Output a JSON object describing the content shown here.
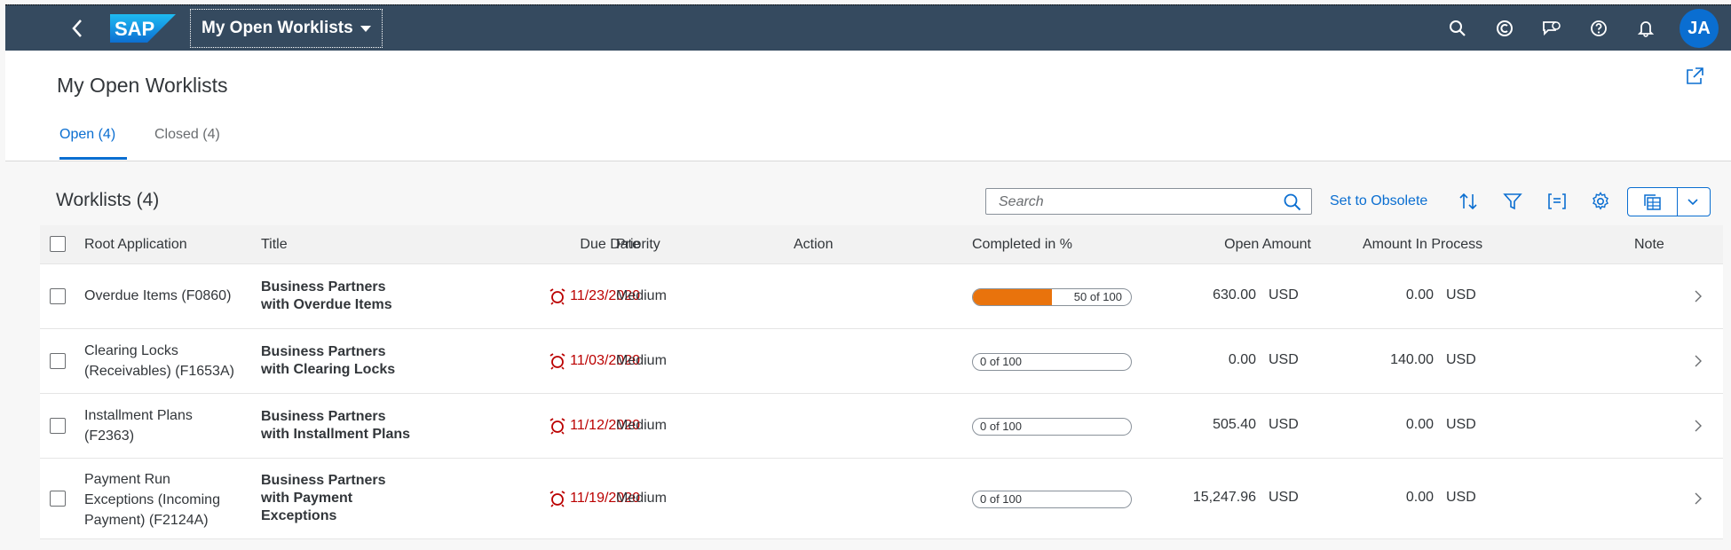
{
  "shell": {
    "app_title": "My Open Worklists",
    "logo_text": "SAP",
    "avatar_initials": "JA",
    "icons": [
      "search-icon",
      "copilot-icon",
      "feedback-icon",
      "help-icon",
      "notifications-icon"
    ]
  },
  "header": {
    "title": "My Open Worklists",
    "tabs": [
      {
        "label": "Open (4)",
        "selected": true
      },
      {
        "label": "Closed (4)",
        "selected": false
      }
    ]
  },
  "toolbar": {
    "title": "Worklists (4)",
    "search_placeholder": "Search",
    "set_obsolete_label": "Set to Obsolete",
    "icons": [
      "sort-icon",
      "filter-icon",
      "group-icon",
      "settings-icon",
      "export-icon",
      "chevron-down-icon"
    ]
  },
  "table": {
    "columns": [
      "Root Application",
      "Title",
      "Due Date",
      "Priority",
      "Action",
      "Completed in %",
      "Open Amount",
      "Amount In Process",
      "Note"
    ],
    "rows": [
      {
        "root_application": [
          "Overdue Items (F0860)"
        ],
        "title": [
          "Business Partners",
          "with Overdue Items"
        ],
        "due_date": "11/23/2020",
        "priority": "Medium",
        "action": "",
        "progress_label": "50 of 100",
        "progress_value": 50,
        "open_amount": "630.00",
        "open_currency": "USD",
        "in_process_amount": "0.00",
        "in_process_currency": "USD"
      },
      {
        "root_application": [
          "Clearing Locks",
          "(Receivables) (F1653A)"
        ],
        "title": [
          "Business Partners",
          "with Clearing Locks"
        ],
        "due_date": "11/03/2020",
        "priority": "Medium",
        "action": "",
        "progress_label": "0 of 100",
        "progress_value": 0,
        "open_amount": "0.00",
        "open_currency": "USD",
        "in_process_amount": "140.00",
        "in_process_currency": "USD"
      },
      {
        "root_application": [
          "Installment Plans",
          "(F2363)"
        ],
        "title": [
          "Business Partners",
          "with Installment Plans"
        ],
        "due_date": "11/12/2020",
        "priority": "Medium",
        "action": "",
        "progress_label": "0 of 100",
        "progress_value": 0,
        "open_amount": "505.40",
        "open_currency": "USD",
        "in_process_amount": "0.00",
        "in_process_currency": "USD"
      },
      {
        "root_application": [
          "Payment Run",
          "Exceptions (Incoming",
          "Payment) (F2124A)"
        ],
        "title": [
          "Business Partners",
          "with Payment",
          "Exceptions"
        ],
        "due_date": "11/19/2020",
        "priority": "Medium",
        "action": "",
        "progress_label": "0 of 100",
        "progress_value": 0,
        "open_amount": "15,247.96",
        "open_currency": "USD",
        "in_process_amount": "0.00",
        "in_process_currency": "USD"
      }
    ]
  },
  "colors": {
    "shell_bg": "#354a5f",
    "accent": "#0a6ed1",
    "overdue": "#bb0000",
    "progress_fill": "#e9730c"
  }
}
